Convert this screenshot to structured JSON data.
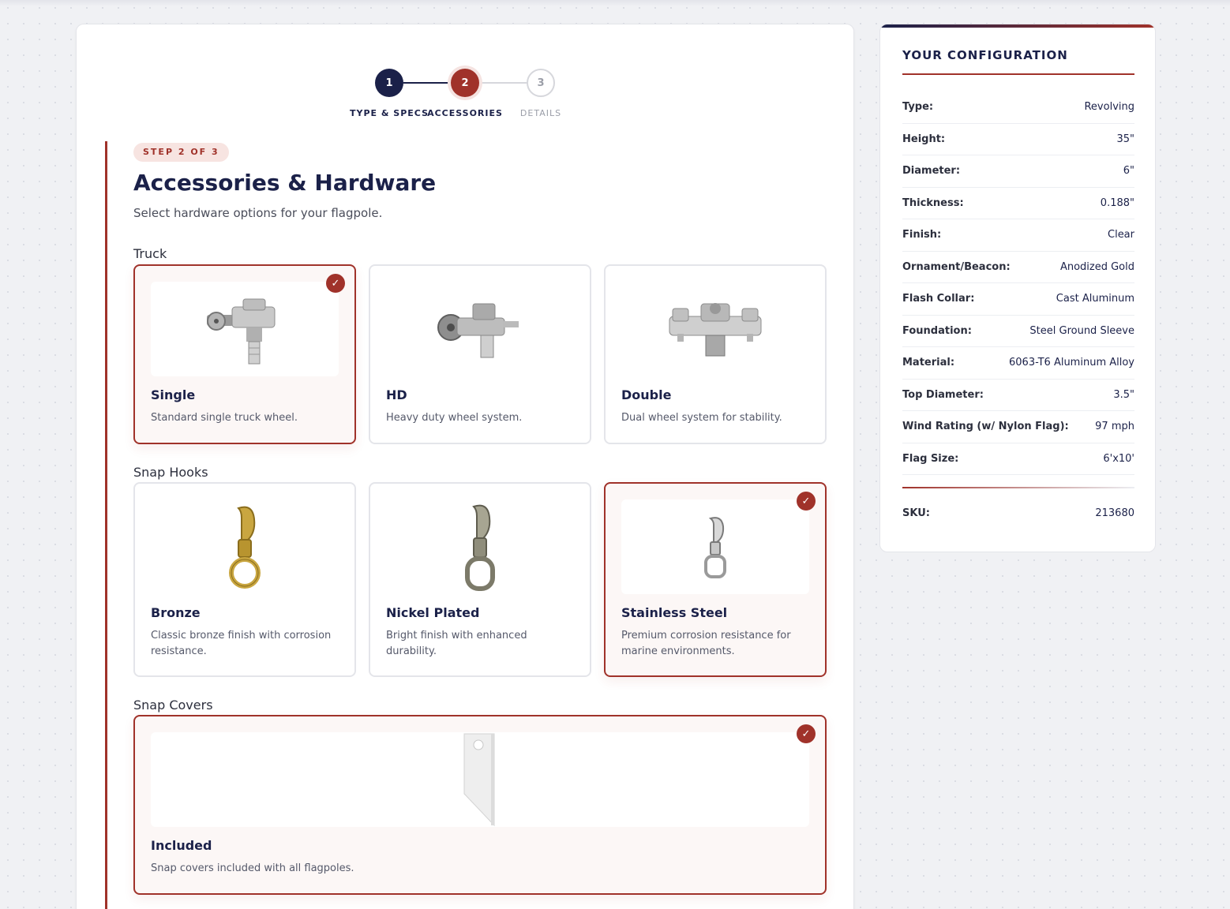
{
  "stepper": {
    "steps": [
      {
        "number": "1",
        "label": "TYPE & SPECS"
      },
      {
        "number": "2",
        "label": "ACCESSORIES"
      },
      {
        "number": "3",
        "label": "DETAILS"
      }
    ]
  },
  "header": {
    "step_pill": "STEP 2 OF 3",
    "title": "Accessories & Hardware",
    "subtitle": "Select hardware options for your flagpole."
  },
  "sections": {
    "truck": {
      "label": "Truck",
      "options": [
        {
          "title": "Single",
          "desc": "Standard single truck wheel.",
          "selected": true
        },
        {
          "title": "HD",
          "desc": "Heavy duty wheel system.",
          "selected": false
        },
        {
          "title": "Double",
          "desc": "Dual wheel system for stability.",
          "selected": false
        }
      ]
    },
    "snap_hooks": {
      "label": "Snap Hooks",
      "options": [
        {
          "title": "Bronze",
          "desc": "Classic bronze finish with corrosion resistance.",
          "selected": false
        },
        {
          "title": "Nickel Plated",
          "desc": "Bright finish with enhanced durability.",
          "selected": false
        },
        {
          "title": "Stainless Steel",
          "desc": "Premium corrosion resistance for marine environments.",
          "selected": true
        }
      ]
    },
    "snap_covers": {
      "label": "Snap Covers",
      "options": [
        {
          "title": "Included",
          "desc": "Snap covers included with all flagpoles.",
          "selected": true
        }
      ]
    }
  },
  "check_glyph": "✓",
  "config": {
    "title": "YOUR CONFIGURATION",
    "rows": [
      {
        "key": "Type:",
        "value": "Revolving"
      },
      {
        "key": "Height:",
        "value": "35\""
      },
      {
        "key": "Diameter:",
        "value": "6\""
      },
      {
        "key": "Thickness:",
        "value": "0.188\""
      },
      {
        "key": "Finish:",
        "value": "Clear"
      },
      {
        "key": "Ornament/Beacon:",
        "value": "Anodized Gold"
      },
      {
        "key": "Flash Collar:",
        "value": "Cast Aluminum"
      },
      {
        "key": "Foundation:",
        "value": "Steel Ground Sleeve"
      },
      {
        "key": "Material:",
        "value": "6063-T6 Aluminum Alloy"
      },
      {
        "key": "Top Diameter:",
        "value": "3.5\""
      },
      {
        "key": "Wind Rating (w/ Nylon Flag):",
        "value": "97 mph"
      },
      {
        "key": "Flag Size:",
        "value": "6'x10'"
      }
    ],
    "sku_label": "SKU:",
    "sku_value": "213680"
  },
  "colors": {
    "navy": "#1b2149",
    "accent": "#a0322a"
  },
  "icons": {
    "truck_single": "single-truck-image",
    "truck_hd": "hd-truck-image",
    "truck_double": "double-truck-image",
    "hook_bronze": "bronze-snap-hook-image",
    "hook_nickel": "nickel-snap-hook-image",
    "hook_stainless": "stainless-snap-hook-image",
    "snap_cover": "snap-cover-image"
  }
}
